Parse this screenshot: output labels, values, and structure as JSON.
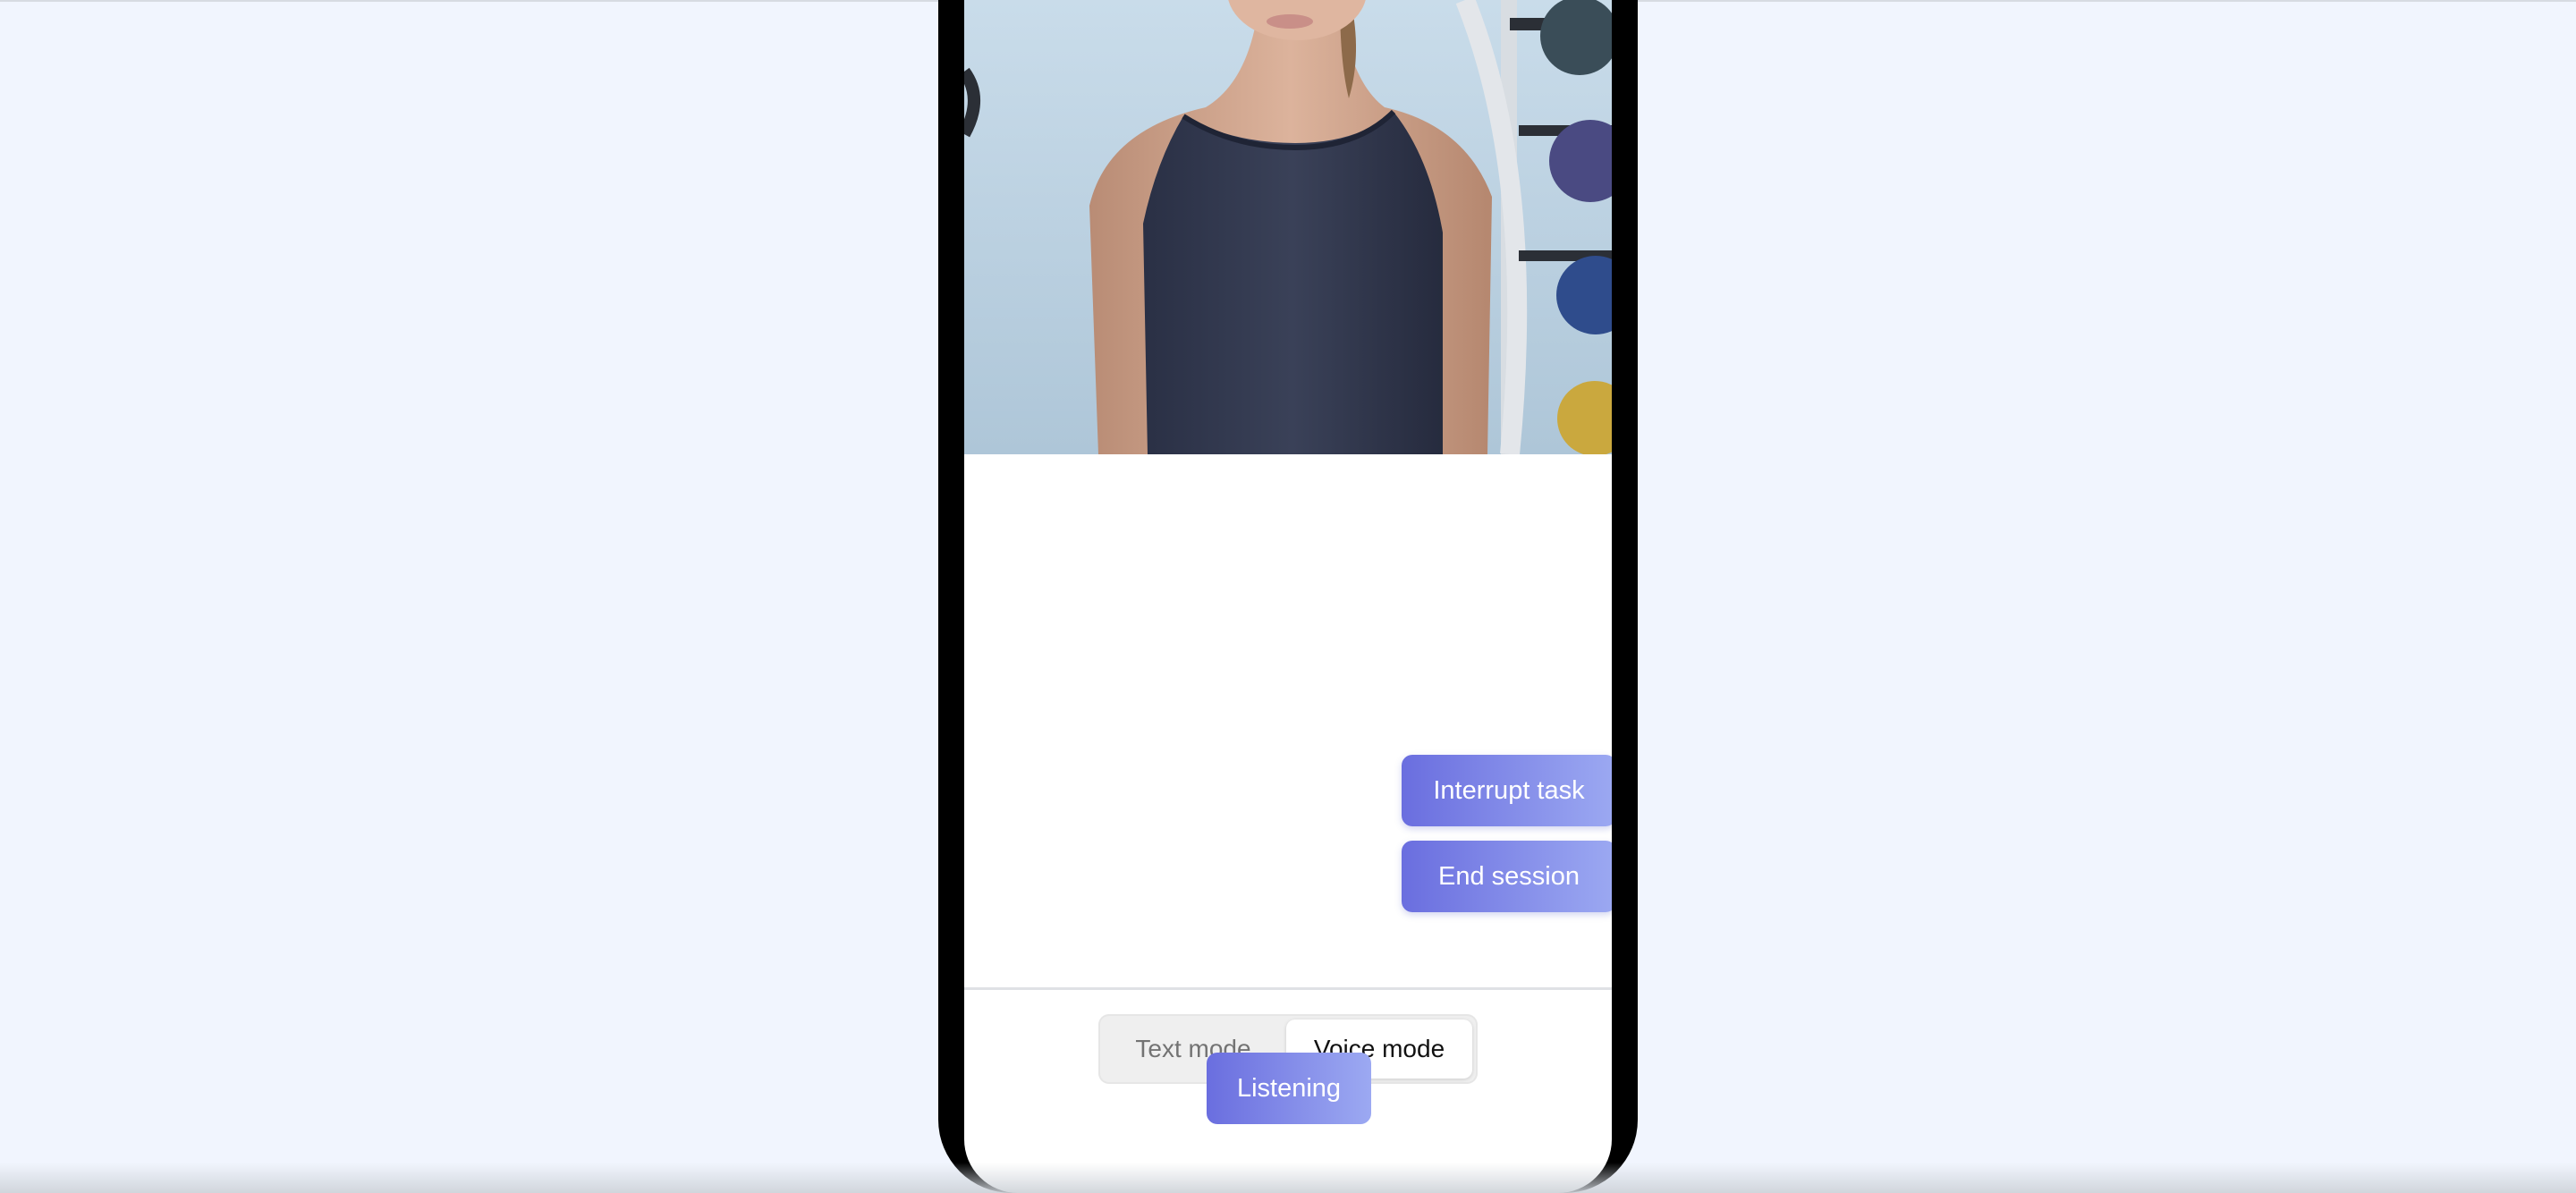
{
  "avatar": {
    "description_icon": "avatar-video-feed"
  },
  "actions": {
    "interrupt_label": "Interrupt task",
    "end_label": "End session"
  },
  "mode_toggle": {
    "options": [
      "Text mode",
      "Voice mode"
    ],
    "selected": "Voice mode"
  },
  "status": {
    "listening_label": "Listening"
  },
  "colors": {
    "page_bg": "#f1f5fe",
    "accent_start": "#6a6edf",
    "accent_end": "#9ca9f2",
    "phone_frame": "#000000"
  }
}
